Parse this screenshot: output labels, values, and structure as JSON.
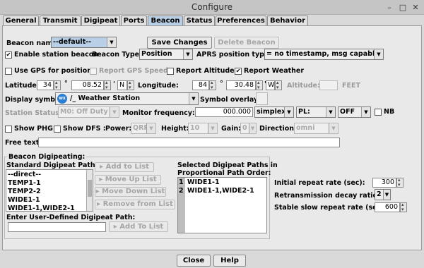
{
  "window": {
    "title": "Configure"
  },
  "tabs": [
    {
      "label": "General"
    },
    {
      "label": "Transmit"
    },
    {
      "label": "Digipeat"
    },
    {
      "label": "Ports"
    },
    {
      "label": "Beacon"
    },
    {
      "label": "Status"
    },
    {
      "label": "Preferences"
    },
    {
      "label": "Behavior"
    }
  ],
  "beacon": {
    "name_label": "Beacon name:",
    "name_value": "--default--",
    "save_changes": "Save Changes",
    "delete_beacon": "Delete Beacon",
    "enable_label": "Enable station beacon",
    "type_label": "Beacon Type:",
    "type_value": "Position",
    "aprs_label": "APRS position type:",
    "aprs_value": "= no timestamp, msg capable",
    "use_gps": "Use GPS for position",
    "report_gps_speed": "Report GPS Speed",
    "report_altitude": "Report Altitude",
    "report_weather": "Report Weather",
    "lat_label": "Latitude:",
    "lat_deg": "34",
    "lat_min": "08.52",
    "lat_hemi": "N",
    "lon_label": "Longitude:",
    "lon_deg": "84",
    "lon_min": "30.48",
    "lon_hemi": "W",
    "degree_symbol": "°",
    "minute_symbol": "'",
    "alt_label": "Altitude:",
    "alt_value": "",
    "alt_unit": "FEET",
    "display_symbol_label": "Display symbol:",
    "display_symbol_value": "/_  Weather Station",
    "symbol_overlay_label": "Symbol overlay:",
    "symbol_overlay_value": "",
    "station_status_label": "Station Status:",
    "station_status_value": "M0: Off Duty",
    "monitor_freq_label": "Monitor frequency:",
    "monitor_freq_value": "000.000",
    "duplex_value": "simplex",
    "pl_value": "PL:",
    "off_value": "OFF",
    "nb_label": "NB",
    "show_phg": "Show PHG",
    "show_dfs": "Show DFS :",
    "power_label": "Power:",
    "power_value": "QRP",
    "height_label": "Height:",
    "height_value": "10",
    "gain_label": "Gain:",
    "gain_value": "0",
    "direction_label": "Direction:",
    "direction_value": "omni",
    "free_text_label": "Free text:",
    "free_text_value": "",
    "digi_group_label": "Beacon Digipeating:",
    "standard_paths_label": "Standard Digipeat Paths:",
    "standard_paths": [
      "--direct--",
      "TEMP1-1",
      "TEMP2-2",
      "WIDE1-1",
      "WIDE1-1,WIDE2-1"
    ],
    "add_to_list": "Add to List",
    "move_up_list": "Move Up List",
    "move_down_list": "Move Down List",
    "remove_from_list": "Remove from List",
    "selected_label_1": "Selected Digipeat Paths in",
    "selected_label_2": "Proportional Path Order:",
    "selected_paths": [
      {
        "num": "1",
        "path": "WIDE1-1"
      },
      {
        "num": "2",
        "path": "WIDE1-1,WIDE2-1"
      }
    ],
    "user_path_label": "Enter User-Defined Digipeat Path:",
    "user_path_value": "",
    "user_add_to_list": "Add To List",
    "initial_repeat_label": "Initial repeat rate (sec):",
    "initial_repeat_value": "300",
    "decay_label": "Retransmission decay ratio:",
    "decay_value": "2",
    "slow_repeat_label": "Stable slow repeat rate (sec):",
    "slow_repeat_value": "600"
  },
  "footer": {
    "close": "Close",
    "help": "Help"
  }
}
